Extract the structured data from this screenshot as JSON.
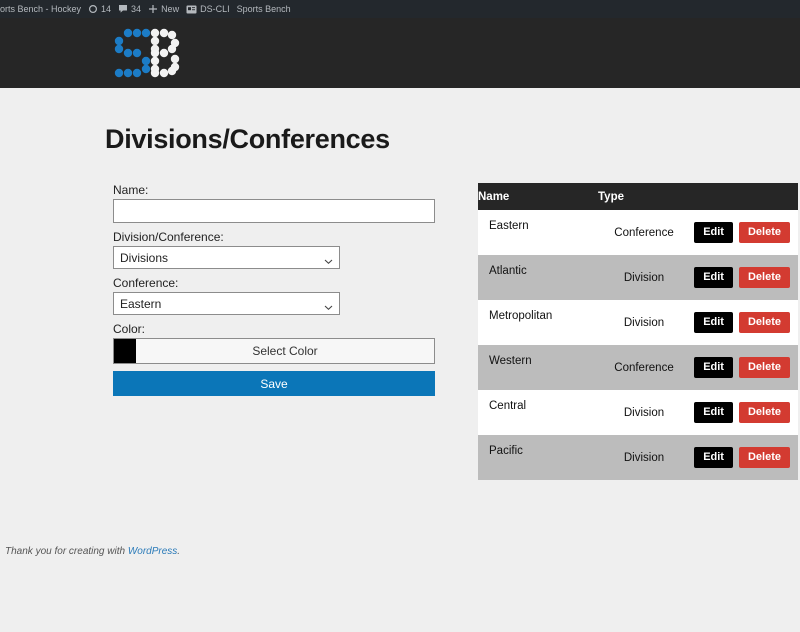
{
  "adminbar": {
    "site_name": "orts Bench - Hockey",
    "updates_icon": "update-circle-icon",
    "updates_count": "14",
    "comments_icon": "comment-bubble-icon",
    "comments_count": "34",
    "new_icon": "plus-icon",
    "new_label": "New",
    "dscli_icon": "badge-icon",
    "dscli_label": "DS-CLI",
    "sports_bench_label": "Sports Bench"
  },
  "header": {
    "logo_name": "sports-bench-sb-logo",
    "logo_blue": "#1c7cc6",
    "logo_white": "#f2f2f2",
    "background": "#262626"
  },
  "page": {
    "title": "Divisions/Conferences"
  },
  "form": {
    "name_label": "Name:",
    "name_value": "",
    "name_placeholder": "",
    "divconf_label": "Division/Conference:",
    "divconf_value": "Divisions",
    "conference_label": "Conference:",
    "conference_value": "Eastern",
    "color_label": "Color:",
    "color_value": "#000000",
    "color_button_label": "Select Color",
    "save_label": "Save",
    "save_color": "#0b76b8"
  },
  "table": {
    "columns": [
      "Name",
      "Type"
    ],
    "edit_label": "Edit",
    "delete_label": "Delete",
    "rows": [
      {
        "name": "Eastern",
        "type": "Conference"
      },
      {
        "name": "Atlantic",
        "type": "Division"
      },
      {
        "name": "Metropolitan",
        "type": "Division"
      },
      {
        "name": "Western",
        "type": "Conference"
      },
      {
        "name": "Central",
        "type": "Division"
      },
      {
        "name": "Pacific",
        "type": "Division"
      }
    ]
  },
  "footer": {
    "text_before": "Thank you for creating with ",
    "link_label": "WordPress",
    "text_after": "."
  }
}
